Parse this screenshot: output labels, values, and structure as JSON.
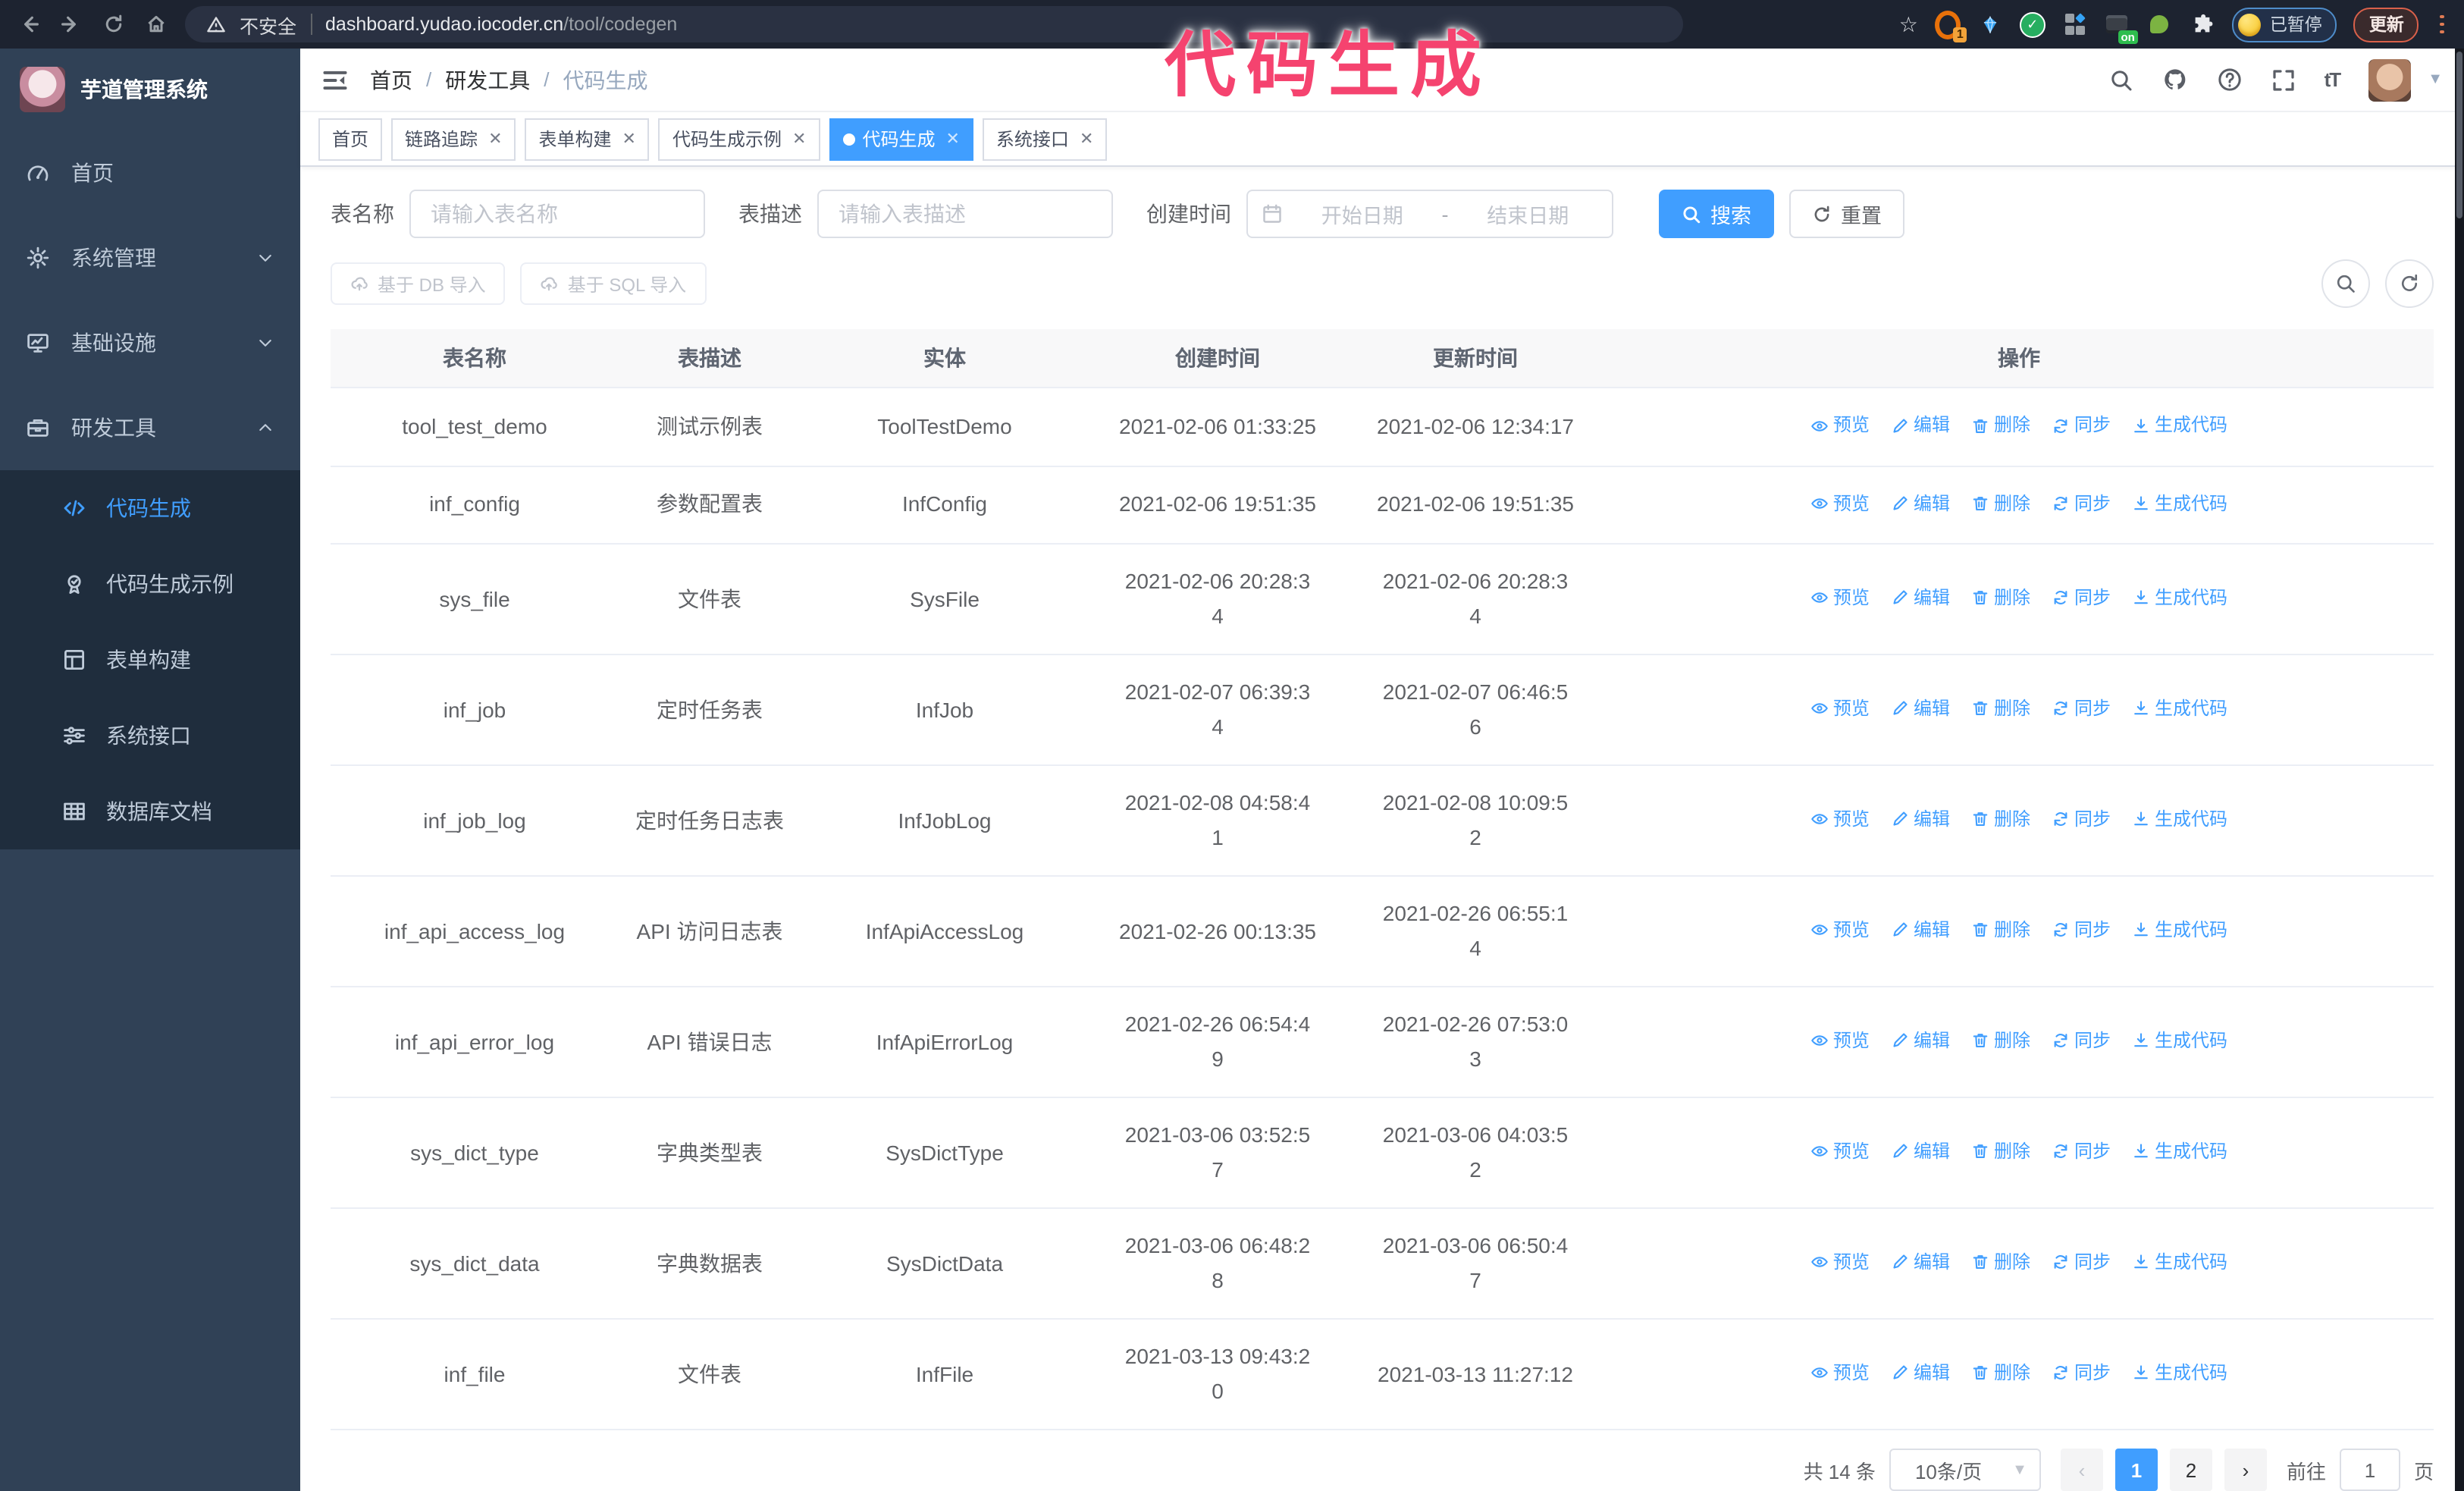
{
  "browser": {
    "security_label": "不安全",
    "url_host": "dashboard.yudao.iocoder.cn",
    "url_path": "/tool/codegen",
    "extension_badge": "1",
    "extension_on_badge": "on",
    "profile_chip": "已暂停",
    "update_button": "更新"
  },
  "annotation": {
    "text": "代码生成",
    "color": "#f5436f"
  },
  "sidebar": {
    "title": "芋道管理系统",
    "items": [
      {
        "label": "首页",
        "icon": "dashboard-icon"
      },
      {
        "label": "系统管理",
        "icon": "gear-icon",
        "chevron": "down"
      },
      {
        "label": "基础设施",
        "icon": "monitor-icon",
        "chevron": "down"
      },
      {
        "label": "研发工具",
        "icon": "toolbox-icon",
        "chevron": "up",
        "children": [
          {
            "label": "代码生成",
            "icon": "code-icon",
            "active": true
          },
          {
            "label": "代码生成示例",
            "icon": "badge-icon"
          },
          {
            "label": "表单构建",
            "icon": "form-icon"
          },
          {
            "label": "系统接口",
            "icon": "sliders-icon"
          },
          {
            "label": "数据库文档",
            "icon": "db-table-icon"
          }
        ]
      }
    ]
  },
  "header": {
    "breadcrumb": [
      "首页",
      "研发工具",
      "代码生成"
    ]
  },
  "tabs": [
    {
      "label": "首页",
      "closable": false,
      "active": false
    },
    {
      "label": "链路追踪",
      "closable": true,
      "active": false
    },
    {
      "label": "表单构建",
      "closable": true,
      "active": false
    },
    {
      "label": "代码生成示例",
      "closable": true,
      "active": false
    },
    {
      "label": "代码生成",
      "closable": true,
      "active": true
    },
    {
      "label": "系统接口",
      "closable": true,
      "active": false
    }
  ],
  "filters": {
    "table_name_label": "表名称",
    "table_name_placeholder": "请输入表名称",
    "table_desc_label": "表描述",
    "table_desc_placeholder": "请输入表描述",
    "create_time_label": "创建时间",
    "date_start_placeholder": "开始日期",
    "date_separator": "-",
    "date_end_placeholder": "结束日期",
    "search_button": "搜索",
    "reset_button": "重置"
  },
  "toolbar": {
    "import_db_button": "基于 DB 导入",
    "import_sql_button": "基于 SQL 导入"
  },
  "table": {
    "headers": [
      "表名称",
      "表描述",
      "实体",
      "创建时间",
      "更新时间",
      "操作"
    ],
    "actions": [
      {
        "label": "预览",
        "icon": "eye-icon"
      },
      {
        "label": "编辑",
        "icon": "edit-icon"
      },
      {
        "label": "删除",
        "icon": "delete-icon"
      },
      {
        "label": "同步",
        "icon": "sync-icon"
      },
      {
        "label": "生成代码",
        "icon": "download-icon"
      }
    ],
    "rows": [
      {
        "name": "tool_test_demo",
        "desc": "测试示例表",
        "entity": "ToolTestDemo",
        "created": "2021-02-06 01:33:25",
        "updated": "2021-02-06 12:34:17"
      },
      {
        "name": "inf_config",
        "desc": "参数配置表",
        "entity": "InfConfig",
        "created": "2021-02-06 19:51:35",
        "updated": "2021-02-06 19:51:35"
      },
      {
        "name": "sys_file",
        "desc": "文件表",
        "entity": "SysFile",
        "created": "2021-02-06 20:28:3\n4",
        "updated": "2021-02-06 20:28:3\n4"
      },
      {
        "name": "inf_job",
        "desc": "定时任务表",
        "entity": "InfJob",
        "created": "2021-02-07 06:39:3\n4",
        "updated": "2021-02-07 06:46:5\n6"
      },
      {
        "name": "inf_job_log",
        "desc": "定时任务日志表",
        "entity": "InfJobLog",
        "created": "2021-02-08 04:58:4\n1",
        "updated": "2021-02-08 10:09:5\n2"
      },
      {
        "name": "inf_api_access_log",
        "desc": "API 访问日志表",
        "entity": "InfApiAccessLog",
        "created": "2021-02-26 00:13:35",
        "updated": "2021-02-26 06:55:1\n4"
      },
      {
        "name": "inf_api_error_log",
        "desc": "API 错误日志",
        "entity": "InfApiErrorLog",
        "created": "2021-02-26 06:54:4\n9",
        "updated": "2021-02-26 07:53:0\n3"
      },
      {
        "name": "sys_dict_type",
        "desc": "字典类型表",
        "entity": "SysDictType",
        "created": "2021-03-06 03:52:5\n7",
        "updated": "2021-03-06 04:03:5\n2"
      },
      {
        "name": "sys_dict_data",
        "desc": "字典数据表",
        "entity": "SysDictData",
        "created": "2021-03-06 06:48:2\n8",
        "updated": "2021-03-06 06:50:4\n7"
      },
      {
        "name": "inf_file",
        "desc": "文件表",
        "entity": "InfFile",
        "created": "2021-03-13 09:43:2\n0",
        "updated": "2021-03-13 11:27:12"
      }
    ]
  },
  "pagination": {
    "total": "共 14 条",
    "page_size": "10条/页",
    "pages": [
      "1",
      "2"
    ],
    "active_page": "1",
    "goto_label": "前往",
    "goto_value": "1",
    "goto_suffix": "页"
  },
  "colors": {
    "accent": "#409eff",
    "annotation": "#f5436f",
    "sidebar_bg": "#304156",
    "submenu_bg": "#1f2d3d",
    "browser_bar_bg": "#1d2330"
  }
}
